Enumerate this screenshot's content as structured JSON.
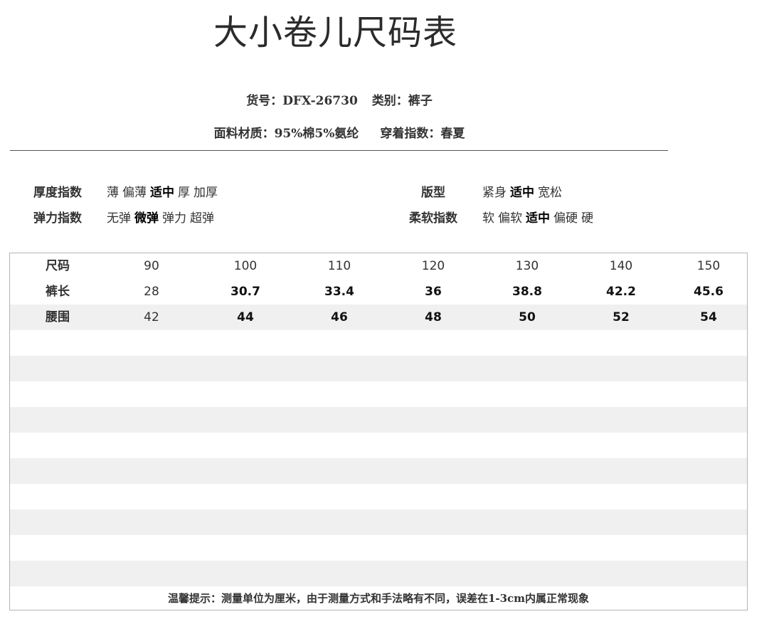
{
  "title": "大小卷儿尺码表",
  "product": {
    "item_no_label": "货号：",
    "item_no": "DFX-26730",
    "category_label": "类别：",
    "category": "裤子",
    "fabric_label": "面料材质：",
    "fabric": "95%棉5%氨纶",
    "season_label": "穿着指数：",
    "season": "春夏"
  },
  "attributes": [
    {
      "label": "厚度指数",
      "options": [
        "薄",
        "偏薄",
        "适中",
        "厚",
        "加厚"
      ],
      "selected": "适中"
    },
    {
      "label": "弹力指数",
      "options": [
        "无弹",
        "微弹",
        "弹力",
        "超弹"
      ],
      "selected": "微弹"
    },
    {
      "label": "版型",
      "options": [
        "紧身",
        "适中",
        "宽松"
      ],
      "selected": "适中"
    },
    {
      "label": "柔软指数",
      "options": [
        "软",
        "偏软",
        "适中",
        "偏硬",
        "硬"
      ],
      "selected": "适中"
    }
  ],
  "size_table": {
    "header": {
      "label": "尺码",
      "values": [
        "90",
        "100",
        "110",
        "120",
        "130",
        "140",
        "150"
      ]
    },
    "rows": [
      {
        "label": "裤长",
        "values": [
          "28",
          "30.7",
          "33.4",
          "36",
          "38.8",
          "42.2",
          "45.6"
        ]
      },
      {
        "label": "腰围",
        "values": [
          "42",
          "44",
          "46",
          "48",
          "50",
          "52",
          "54"
        ]
      }
    ]
  },
  "footnote": "温馨提示：测量单位为厘米，由于测量方式和手法略有不同，误差在1-3cm内属正常现象"
}
